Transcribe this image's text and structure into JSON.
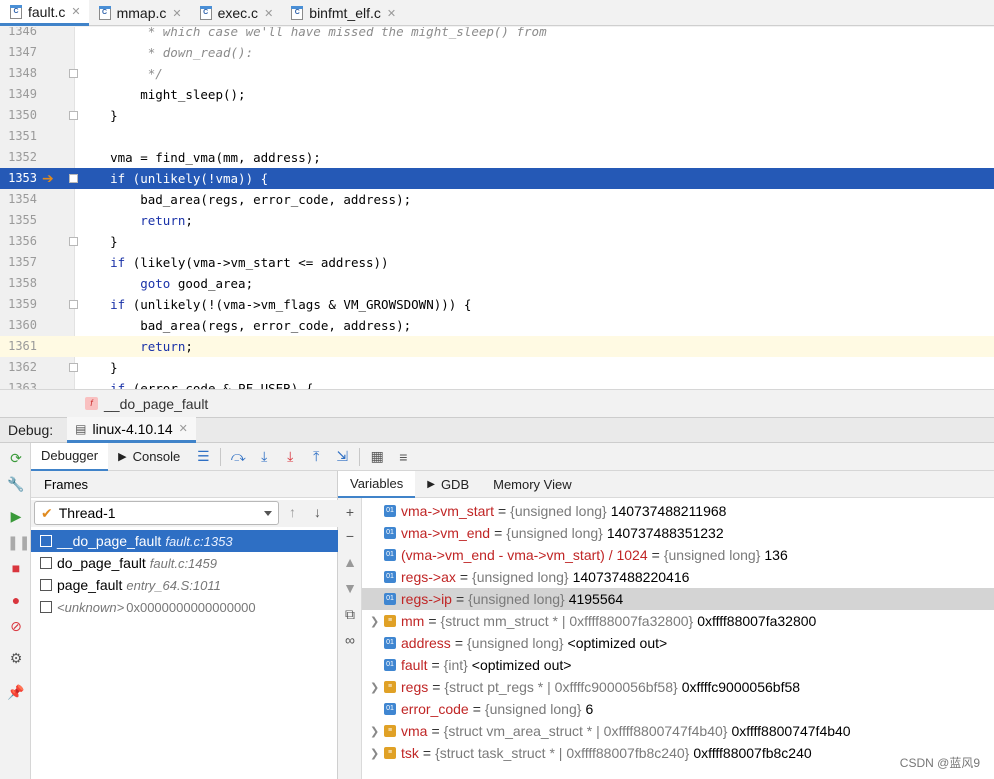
{
  "tabs": [
    {
      "label": "fault.c",
      "active": true,
      "icon": "c-file-icon"
    },
    {
      "label": "mmap.c",
      "active": false,
      "icon": "c-file-icon"
    },
    {
      "label": "exec.c",
      "active": false,
      "icon": "c-file-icon"
    },
    {
      "label": "binfmt_elf.c",
      "active": false,
      "icon": "c-file-icon"
    }
  ],
  "editor": {
    "lines": [
      {
        "num": "1346",
        "code": "         * which case we'll have missed the might_sleep() from",
        "type": "comment"
      },
      {
        "num": "1347",
        "code": "         * down_read():",
        "type": "comment"
      },
      {
        "num": "1348",
        "code": "         */",
        "type": "comment"
      },
      {
        "num": "1349",
        "code": "        might_sleep();",
        "type": "code"
      },
      {
        "num": "1350",
        "code": "    }",
        "type": "code"
      },
      {
        "num": "1351",
        "code": "",
        "type": "code"
      },
      {
        "num": "1352",
        "code": "    vma = find_vma(mm, address);",
        "type": "code"
      },
      {
        "num": "1353",
        "code": "    if (unlikely(!vma)) {",
        "type": "highlight"
      },
      {
        "num": "1354",
        "code": "        bad_area(regs, error_code, address);",
        "type": "code"
      },
      {
        "num": "1355",
        "code": "        return;",
        "type": "kw"
      },
      {
        "num": "1356",
        "code": "    }",
        "type": "code"
      },
      {
        "num": "1357",
        "code": "    if (likely(vma->vm_start <= address))",
        "type": "kwstart"
      },
      {
        "num": "1358",
        "code": "        goto good_area;",
        "type": "kwstart"
      },
      {
        "num": "1359",
        "code": "    if (unlikely(!(vma->vm_flags & VM_GROWSDOWN))) {",
        "type": "kwstart"
      },
      {
        "num": "1360",
        "code": "        bad_area(regs, error_code, address);",
        "type": "code"
      },
      {
        "num": "1361",
        "code": "        return;",
        "type": "current"
      },
      {
        "num": "1362",
        "code": "    }",
        "type": "code"
      },
      {
        "num": "1363",
        "code": "    if (error_code & PF_USER) {",
        "type": "kwstart"
      }
    ]
  },
  "breadcrumb": {
    "badge": "f",
    "label": "__do_page_fault"
  },
  "debug": {
    "label": "Debug:",
    "session": "linux-4.10.14",
    "toolbar": {
      "debugger": "Debugger",
      "console": "Console"
    }
  },
  "frames": {
    "title": "Frames",
    "thread": "Thread-1",
    "rows": [
      {
        "func": "__do_page_fault",
        "loc": "fault.c:1353",
        "selected": true
      },
      {
        "func": "do_page_fault",
        "loc": "fault.c:1459",
        "selected": false
      },
      {
        "func": "page_fault",
        "loc": "entry_64.S:1011",
        "selected": false
      },
      {
        "func": "<unknown>",
        "loc": "0x0000000000000000",
        "selected": false,
        "unknown": true
      }
    ]
  },
  "variables": {
    "tabs": [
      "Variables",
      "GDB",
      "Memory View"
    ],
    "rows": [
      {
        "expandable": false,
        "icon": "prim",
        "name": "vma->vm_start",
        "type": "{unsigned long}",
        "value": "140737488211968"
      },
      {
        "expandable": false,
        "icon": "prim",
        "name": "vma->vm_end",
        "type": "{unsigned long}",
        "value": "140737488351232"
      },
      {
        "expandable": false,
        "icon": "prim",
        "name": "(vma->vm_end - vma->vm_start) / 1024",
        "type": "{unsigned long}",
        "value": "136"
      },
      {
        "expandable": false,
        "icon": "prim",
        "name": "regs->ax",
        "type": "{unsigned long}",
        "value": "140737488220416"
      },
      {
        "expandable": false,
        "icon": "prim",
        "name": "regs->ip",
        "type": "{unsigned long}",
        "value": "4195564",
        "selected": true
      },
      {
        "expandable": true,
        "icon": "struct",
        "name": "mm",
        "type": "{struct mm_struct * | 0xffff88007fa32800}",
        "value": "0xffff88007fa32800"
      },
      {
        "expandable": false,
        "icon": "prim",
        "name": "address",
        "type": "{unsigned long}",
        "value": "<optimized out>"
      },
      {
        "expandable": false,
        "icon": "prim",
        "name": "fault",
        "type": "{int}",
        "value": "<optimized out>"
      },
      {
        "expandable": true,
        "icon": "struct",
        "name": "regs",
        "type": "{struct pt_regs * | 0xffffc9000056bf58}",
        "value": "0xffffc9000056bf58"
      },
      {
        "expandable": false,
        "icon": "prim",
        "name": "error_code",
        "type": "{unsigned long}",
        "value": "6"
      },
      {
        "expandable": true,
        "icon": "struct",
        "name": "vma",
        "type": "{struct vm_area_struct * | 0xffff8800747f4b40}",
        "value": "0xffff8800747f4b40"
      },
      {
        "expandable": true,
        "icon": "struct",
        "name": "tsk",
        "type": "{struct task_struct * | 0xffff88007fb8c240}",
        "value": "0xffff88007fb8c240"
      }
    ]
  },
  "watermark": "CSDN @蓝风9"
}
